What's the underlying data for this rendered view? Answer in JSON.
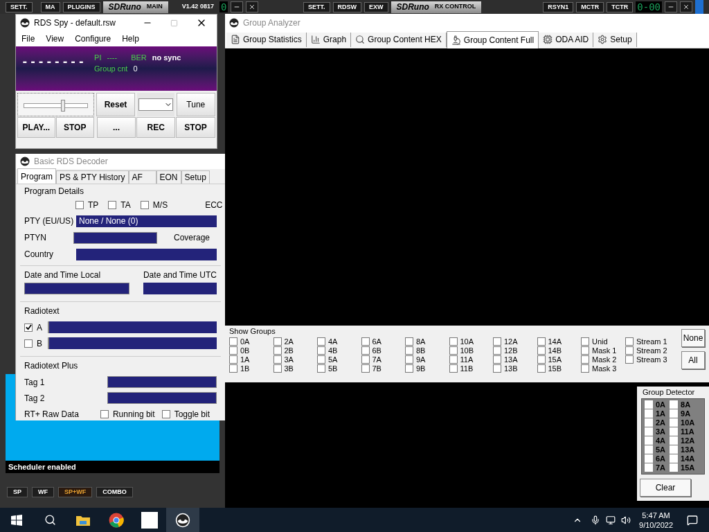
{
  "sdruno_main": {
    "buttons": [
      "SETT.",
      "MA",
      "PLUGINS"
    ],
    "logo": "SDRuno",
    "logo_sub": "MAIN",
    "version": "V1.42 0817",
    "display": "0"
  },
  "rx_control": {
    "buttons": [
      "SETT.",
      "RDSW",
      "EXW"
    ],
    "logo": "SDRuno",
    "logo_sub": "RX CONTROL",
    "buttons_right": [
      "RSYN1",
      "MCTR",
      "TCTR"
    ],
    "display": "0-00"
  },
  "main_panel": {
    "status": "Scheduler enabled",
    "view_buttons": [
      {
        "label": "SP",
        "selected": false
      },
      {
        "label": "WF",
        "selected": false
      },
      {
        "label": "SP+WF",
        "selected": true
      },
      {
        "label": "COMBO",
        "selected": false
      }
    ]
  },
  "rds_spy": {
    "title": "RDS Spy - default.rsw",
    "menu": [
      "File",
      "View",
      "Configure",
      "Help"
    ],
    "ps": "--------",
    "pi_label": "PI",
    "pi": "----",
    "ber_label": "BER",
    "sync": "no sync",
    "group_cnt_label": "Group cnt",
    "group_cnt": "0",
    "level": 0.6,
    "reset": "Reset",
    "tune": "Tune",
    "buttons": [
      "PLAY...",
      "STOP",
      "...",
      "REC",
      "STOP"
    ]
  },
  "decoder": {
    "title": "Basic RDS Decoder",
    "tabs": [
      {
        "label": "Program",
        "selected": true
      },
      {
        "label": "PS & PTY History",
        "selected": false
      },
      {
        "label": "AF",
        "selected": false
      },
      {
        "label": "EON",
        "selected": false
      },
      {
        "label": "Setup",
        "selected": false
      }
    ],
    "program_details": {
      "title": "Program Details",
      "flags": [
        {
          "label": "TP",
          "checked": false
        },
        {
          "label": "TA",
          "checked": false
        },
        {
          "label": "M/S",
          "checked": false
        }
      ],
      "ecc_label": "ECC",
      "pty_label": "PTY (EU/US)",
      "pty": "None / None (0)",
      "ptyn_label": "PTYN",
      "coverage_label": "Coverage",
      "country_label": "Country"
    },
    "date_local_label": "Date and Time Local",
    "date_utc_label": "Date and Time UTC",
    "radiotext": {
      "title": "Radiotext",
      "lines": [
        {
          "label": "A",
          "checked": true
        },
        {
          "label": "B",
          "checked": false
        }
      ]
    },
    "rt_plus": {
      "title": "Radiotext Plus",
      "tags": [
        "Tag 1",
        "Tag 2"
      ],
      "raw_label": "RT+ Raw Data",
      "bits": [
        {
          "label": "Running bit",
          "checked": false
        },
        {
          "label": "Toggle bit",
          "checked": false
        }
      ]
    }
  },
  "group_analyzer": {
    "title": "Group Analyzer",
    "tabs": [
      {
        "label": "Group Statistics",
        "selected": false
      },
      {
        "label": "Graph",
        "selected": false
      },
      {
        "label": "Group Content HEX",
        "selected": false
      },
      {
        "label": "Group Content Full",
        "selected": true
      },
      {
        "label": "ODA AID",
        "selected": false
      },
      {
        "label": "Setup",
        "selected": false
      }
    ],
    "show_groups": {
      "title": "Show Groups",
      "groups": [
        {
          "label": "0A",
          "checked": false
        },
        {
          "label": "0B",
          "checked": false
        },
        {
          "label": "1A",
          "checked": false
        },
        {
          "label": "1B",
          "checked": false
        },
        {
          "label": "2A",
          "checked": false
        },
        {
          "label": "2B",
          "checked": false
        },
        {
          "label": "3A",
          "checked": false
        },
        {
          "label": "3B",
          "checked": false
        },
        {
          "label": "4A",
          "checked": false
        },
        {
          "label": "4B",
          "checked": false
        },
        {
          "label": "5A",
          "checked": false
        },
        {
          "label": "5B",
          "checked": false
        },
        {
          "label": "6A",
          "checked": false
        },
        {
          "label": "6B",
          "checked": false
        },
        {
          "label": "7A",
          "checked": false
        },
        {
          "label": "7B",
          "checked": false
        },
        {
          "label": "8A",
          "checked": false
        },
        {
          "label": "8B",
          "checked": false
        },
        {
          "label": "9A",
          "checked": false
        },
        {
          "label": "9B",
          "checked": false
        },
        {
          "label": "10A",
          "checked": false
        },
        {
          "label": "10B",
          "checked": false
        },
        {
          "label": "11A",
          "checked": false
        },
        {
          "label": "11B",
          "checked": false
        },
        {
          "label": "12A",
          "checked": false
        },
        {
          "label": "12B",
          "checked": false
        },
        {
          "label": "13A",
          "checked": false
        },
        {
          "label": "13B",
          "checked": false
        },
        {
          "label": "14A",
          "checked": false
        },
        {
          "label": "14B",
          "checked": false
        },
        {
          "label": "15A",
          "checked": false
        },
        {
          "label": "15B",
          "checked": false
        },
        {
          "label": "Unid",
          "checked": false
        },
        {
          "label": "Mask 1",
          "checked": false
        },
        {
          "label": "Mask 2",
          "checked": false
        },
        {
          "label": "Mask 3",
          "checked": false
        },
        {
          "label": "Stream 1",
          "checked": false
        },
        {
          "label": "Stream 2",
          "checked": false
        },
        {
          "label": "Stream 3",
          "checked": false
        }
      ],
      "buttons": [
        "None",
        "All"
      ]
    },
    "group_detector": {
      "title": "Group Detector",
      "groups": [
        {
          "label": "0A",
          "checked": false
        },
        {
          "label": "1A",
          "checked": false
        },
        {
          "label": "2A",
          "checked": false
        },
        {
          "label": "3A",
          "checked": false
        },
        {
          "label": "4A",
          "checked": false
        },
        {
          "label": "5A",
          "checked": false
        },
        {
          "label": "6A",
          "checked": false
        },
        {
          "label": "7A",
          "checked": false
        },
        {
          "label": "8A",
          "checked": false
        },
        {
          "label": "9A",
          "checked": false
        },
        {
          "label": "10A",
          "checked": false
        },
        {
          "label": "11A",
          "checked": false
        },
        {
          "label": "12A",
          "checked": false
        },
        {
          "label": "13A",
          "checked": false
        },
        {
          "label": "14A",
          "checked": false
        },
        {
          "label": "15A",
          "checked": false
        }
      ],
      "clear": "Clear"
    }
  },
  "taskbar": {
    "time": "5:47 AM",
    "date": "9/10/2022"
  }
}
